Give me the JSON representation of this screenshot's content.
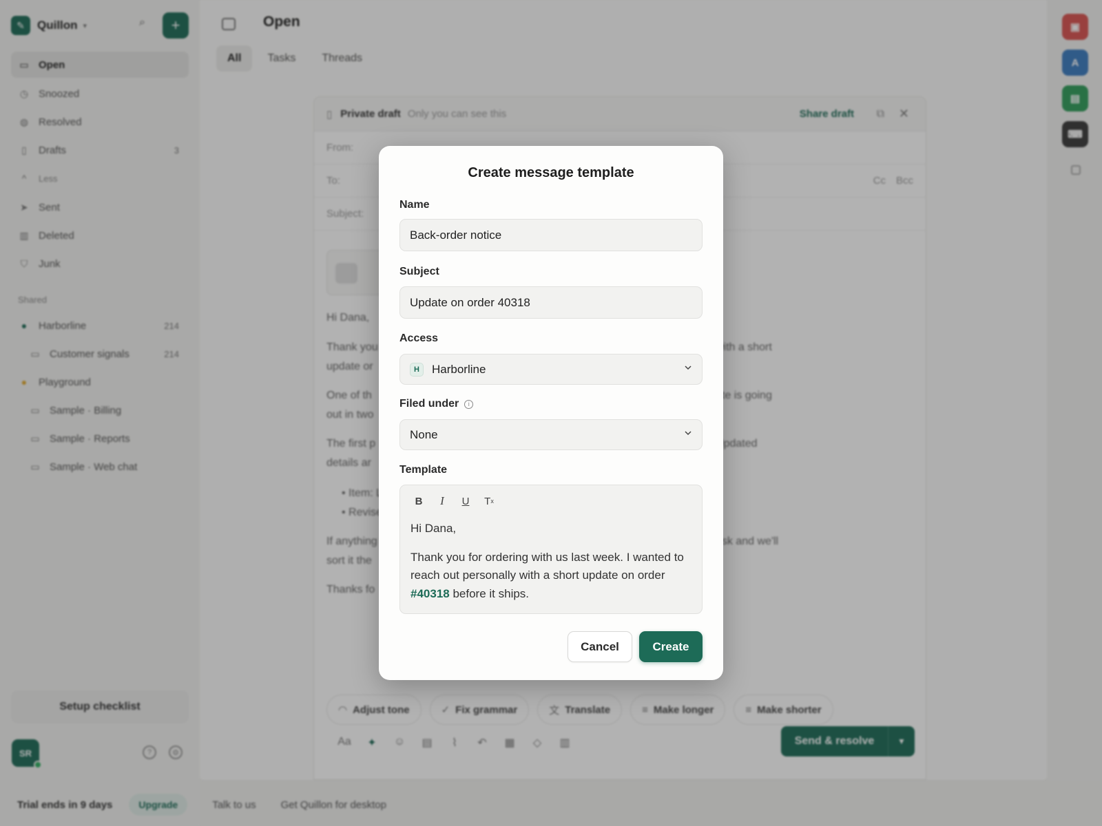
{
  "app": {
    "workspace": "Quillon",
    "view_title": "Open",
    "tabs": [
      "All",
      "Tasks",
      "Threads"
    ],
    "active_tab": "All"
  },
  "sidebar": {
    "items": [
      {
        "label": "Open",
        "icon": "inbox-icon",
        "active": true
      },
      {
        "label": "Snoozed",
        "icon": "clock-icon"
      },
      {
        "label": "Resolved",
        "icon": "check-circle-icon"
      },
      {
        "label": "Drafts",
        "icon": "file-icon",
        "count": "3"
      },
      {
        "label": "Less",
        "icon": "chevron-up-icon"
      },
      {
        "label": "Sent",
        "icon": "send-icon"
      },
      {
        "label": "Deleted",
        "icon": "trash-icon"
      },
      {
        "label": "Junk",
        "icon": "shield-icon"
      }
    ],
    "shared_label": "Shared",
    "shared": [
      {
        "label": "Harborline",
        "count": "214"
      },
      {
        "label": "Customer signals",
        "count": "214"
      },
      {
        "label": "Playground",
        "count": ""
      },
      {
        "label": "Sample · Billing",
        "count": ""
      },
      {
        "label": "Sample · Reports",
        "count": ""
      },
      {
        "label": "Sample · Web chat",
        "count": ""
      }
    ],
    "setup_checklist": "Setup checklist",
    "avatar_initials": "SR"
  },
  "bottom_bar": {
    "trial": "Trial ends in 9 days",
    "upgrade": "Upgrade",
    "talk": "Talk to us",
    "desktop": "Get Quillon for desktop"
  },
  "draft": {
    "title": "Private draft",
    "subtitle": "Only you can see this",
    "share": "Share draft",
    "from_label": "From:",
    "to_label": "To:",
    "cc": "Cc",
    "bcc": "Bcc",
    "subject_label": "Subject:",
    "body_lines": [
      "Hi Dana,",
      "Thank you",
      "update or",
      "One of th",
      "out in two",
      "The first p",
      "details ar",
      "If anything",
      "sort it the",
      "Thanks fo"
    ],
    "body_right": [
      "with a short",
      "ate is going",
      "Updated",
      "esk and we'll"
    ],
    "ai_actions": [
      "Adjust tone",
      "Fix grammar",
      "Translate",
      "Make longer",
      "Make shorter"
    ],
    "send_label": "Send & resolve"
  },
  "modal": {
    "title": "Create message template",
    "name_label": "Name",
    "name_value": "Back-order notice",
    "subject_label": "Subject",
    "subject_value": "Update on order 40318",
    "access_label": "Access",
    "access_badge": "H",
    "access_value": "Harborline",
    "filed_label": "Filed under",
    "filed_value": "None",
    "template_label": "Template",
    "template_greeting": "Hi Dana,",
    "template_body": "Thank you for ordering with us last week. I wanted to reach out personally with a short update on order",
    "template_tag": "#40318",
    "template_tail": "before it ships.",
    "cancel": "Cancel",
    "create": "Create"
  },
  "colors": {
    "brand": "#1d6b57",
    "rail": [
      "#d9534f",
      "#3b7bbf",
      "#2f9d5a",
      "#3a3a3a"
    ]
  }
}
